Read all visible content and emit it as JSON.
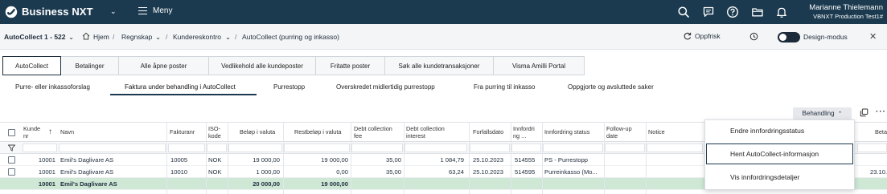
{
  "app": {
    "name": "Business NXT",
    "menu_label": "Meny",
    "user_name": "Marianne Thielemann",
    "company": "VBNXT Production Test1#"
  },
  "breadcrumb": {
    "context": "AutoCollect 1 - 522",
    "home": "Hjem",
    "items": [
      "Regnskap",
      "Kundereskontro",
      "AutoCollect (purring og inkasso)"
    ],
    "separator": "/"
  },
  "actions": {
    "refresh": "Oppfrisk",
    "design_mode": "Design-modus"
  },
  "main_tabs": [
    "AutoCollect",
    "Betalinger",
    "Alle åpne poster",
    "Vedlikehold alle kundeposter",
    "Fritatte poster",
    "Søk alle kundetransaksjoner",
    "Visma Amilli Portal"
  ],
  "sub_tabs": [
    "Purre- eller inkassoforslag",
    "Faktura under behandling i AutoCollect",
    "Purrestopp",
    "Overskredet midlertidig purrestopp",
    "Fra purring til inkasso",
    "Oppgjorte og avsluttede saker"
  ],
  "toolbar": {
    "behandling": "Behandling"
  },
  "table": {
    "headers": {
      "kundenr": "Kunde nr",
      "navn": "Navn",
      "fakturanr": "Fakturanr",
      "iso": "ISO-kode",
      "belop": "Beløp i valuta",
      "restbelop": "Restbeløp i valuta",
      "debtfee": "Debt collection fee",
      "debtint": "Debt collection interest",
      "forfall": "Forfallsdato",
      "innfnr": "Innfordri ng ...",
      "innfstatus": "Innfordring status",
      "followup": "Follow-up date",
      "notice": "Notice",
      "right_cut": "Beta"
    },
    "rows": [
      {
        "kundenr": "10001",
        "navn": "Emil's Daglivare AS",
        "fakturanr": "10005",
        "iso": "NOK",
        "belop": "19 000,00",
        "restbelop": "19 000,00",
        "debtfee": "35,00",
        "debtint": "1 084,79",
        "forfall": "25.10.2023",
        "innfnr": "514555",
        "innfstatus": "PS - Purrestopp",
        "right_cut": ""
      },
      {
        "kundenr": "10001",
        "navn": "Emil's Daglivare AS",
        "fakturanr": "10010",
        "iso": "NOK",
        "belop": "1 000,00",
        "restbelop": "0,00",
        "debtfee": "35,00",
        "debtint": "63,24",
        "forfall": "25.10.2023",
        "innfnr": "514595",
        "innfstatus": "Purreinkasso (Mo...",
        "right_cut": "23.10."
      }
    ],
    "total": {
      "kundenr": "10001",
      "navn": "Emil's Daglivare AS",
      "belop": "20 000,00",
      "restbelop": "19 000,00"
    }
  },
  "dropdown": {
    "items": [
      "Endre innfordringsstatus",
      "Hent AutoCollect-informasjon",
      "Vis innfordringsdetaljer"
    ]
  },
  "icons": {
    "logo": "visma-logo-icon",
    "search": "search-icon",
    "chat": "chat-icon",
    "help": "help-icon",
    "folder": "folder-icon",
    "bell": "bell-icon",
    "home": "home-icon",
    "refresh": "refresh-icon",
    "history": "history-icon",
    "close": "close-icon",
    "copy": "copy-icon",
    "more": "more-icon",
    "filter": "filter-icon",
    "sort": "sort-up-icon"
  },
  "colors": {
    "topbar": "#1b3a4f",
    "total_row": "#cfe8d6",
    "accent": "#1b3a4f"
  }
}
